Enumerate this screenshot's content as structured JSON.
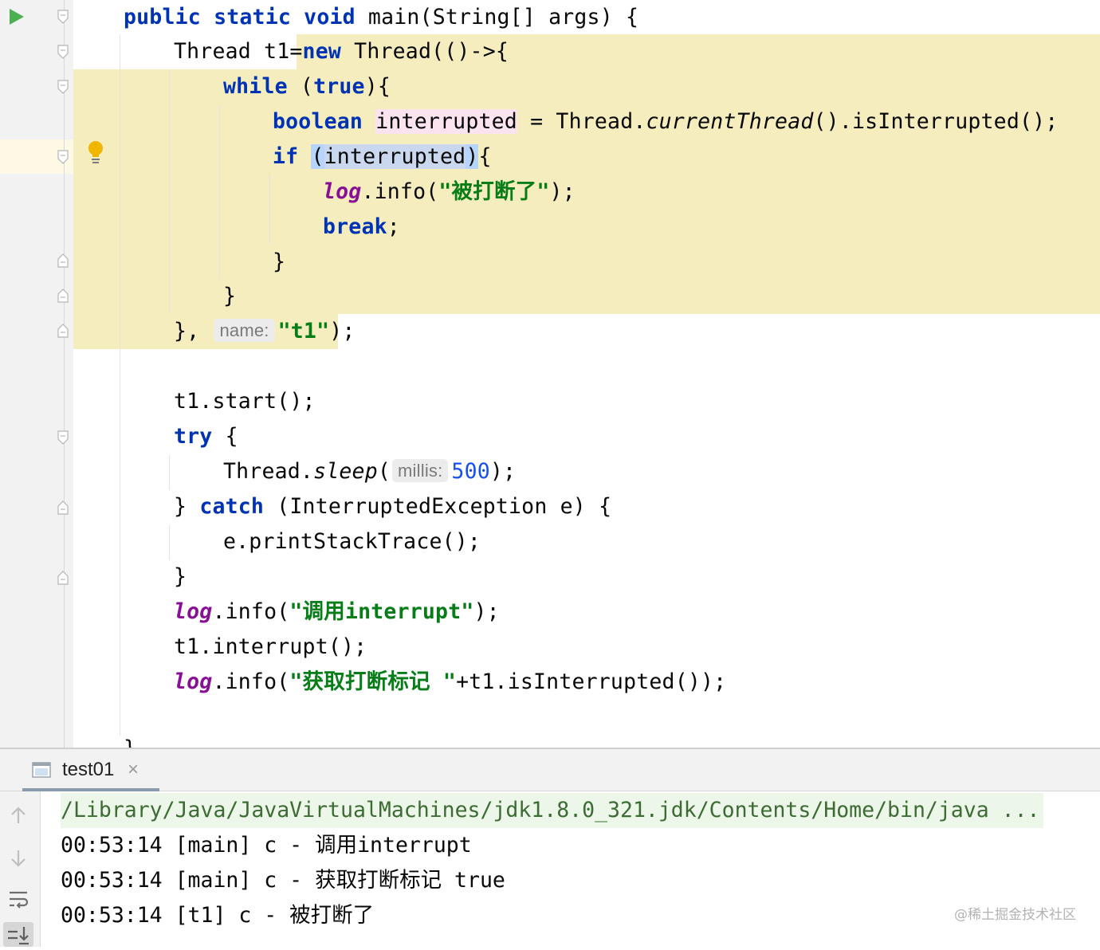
{
  "editor": {
    "lines": {
      "l1": {
        "kw1": "public static void",
        "rest": " main(String[] args) {"
      },
      "l2": {
        "a": "Thread t1=",
        "kw": "new",
        "b": " Thread(()->{"
      },
      "l3": {
        "kw": "while",
        "a": " (",
        "kw2": "true",
        "b": "){"
      },
      "l4": {
        "kw": "boolean",
        "sp": " ",
        "var": "interrupted",
        "a": " = Thread.",
        "it": "currentThread",
        "b": "().isInterrupted();"
      },
      "l5": {
        "kw": "if",
        "sp": " ",
        "p1": "(",
        "var": "interrupted",
        "p2": ")",
        "b": "{"
      },
      "l6": {
        "log": "log",
        "a": ".info(",
        "str": "\"被打断了\"",
        "b": ");"
      },
      "l7": {
        "kw": "break",
        "b": ";"
      },
      "l8": {
        "a": "}"
      },
      "l9": {
        "a": "}"
      },
      "l10": {
        "a": "}, ",
        "hint": "name:",
        "str": "\"t1\"",
        "b": ");"
      },
      "l12": {
        "a": "t1.start();"
      },
      "l13": {
        "kw": "try",
        "b": " {"
      },
      "l14": {
        "a": "Thread.",
        "it": "sleep",
        "b": "(",
        "hint": "millis:",
        "num": "500",
        "c": ");"
      },
      "l15": {
        "a": "} ",
        "kw": "catch",
        "b": " (InterruptedException e) {"
      },
      "l16": {
        "a": "e.printStackTrace();"
      },
      "l17": {
        "a": "}"
      },
      "l18": {
        "log": "log",
        "a": ".info(",
        "str": "\"调用interrupt\"",
        "b": ");"
      },
      "l19": {
        "a": "t1.interrupt();"
      },
      "l20": {
        "log": "log",
        "a": ".info(",
        "str": "\"获取打断标记 \"",
        "b": "+t1.isInterrupted());"
      },
      "l22": {
        "a": "}"
      }
    }
  },
  "run_panel": {
    "tab_label": "test01",
    "tab_close": "×",
    "output": {
      "cmd": "/Library/Java/JavaVirtualMachines/jdk1.8.0_321.jdk/Contents/Home/bin/java ...",
      "line1": "00:53:14 [main] c - 调用interrupt",
      "line2": "00:53:14 [main] c - 获取打断标记 true",
      "line3": "00:53:14 [t1] c - 被打断了"
    }
  },
  "watermark": "@稀土掘金技术社区",
  "colors": {
    "keyword": "#0033b3",
    "string": "#067d17",
    "log_field": "#871094",
    "number": "#1750eb",
    "lambda_highlight": "#f5edbd",
    "run_icon": "#4caf50"
  },
  "icons": [
    "run-icon",
    "fold-icon",
    "bulb-icon",
    "console-tab-icon",
    "close-icon",
    "up-arrow-icon",
    "down-arrow-icon",
    "soft-wrap-icon",
    "scroll-to-end-icon"
  ]
}
